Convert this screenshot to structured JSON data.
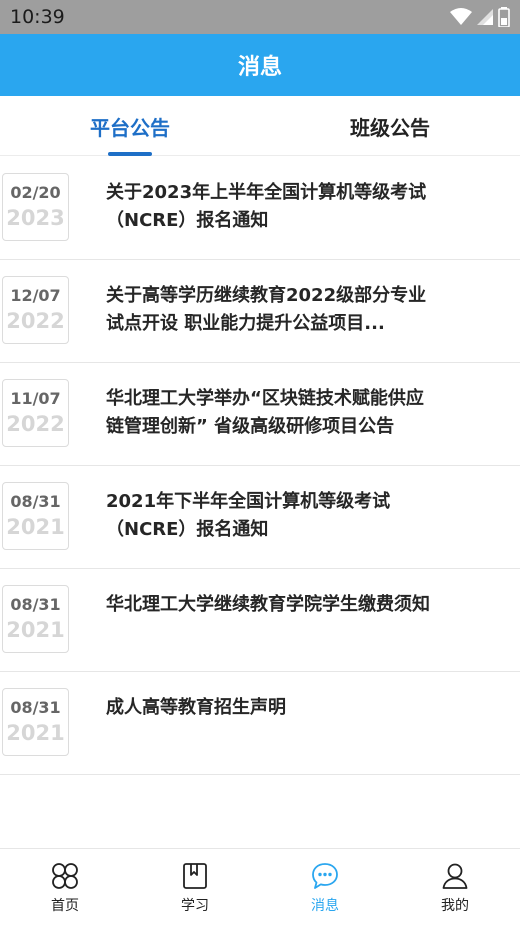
{
  "status_bar": {
    "time": "10:39"
  },
  "header": {
    "title": "消息"
  },
  "tabs": [
    {
      "label": "平台公告",
      "active": true
    },
    {
      "label": "班级公告",
      "active": false
    }
  ],
  "notices": [
    {
      "month_day": "02/20",
      "year": "2023",
      "title": "关于2023年上半年全国计算机等级考试（NCRE）报名通知"
    },
    {
      "month_day": "12/07",
      "year": "2022",
      "title": "关于高等学历继续教育2022级部分专业试点开设 职业能力提升公益项目..."
    },
    {
      "month_day": "11/07",
      "year": "2022",
      "title": "华北理工大学举办“区块链技术赋能供应链管理创新” 省级高级研修项目公告"
    },
    {
      "month_day": "08/31",
      "year": "2021",
      "title": "2021年下半年全国计算机等级考试（NCRE）报名通知"
    },
    {
      "month_day": "08/31",
      "year": "2021",
      "title": "华北理工大学继续教育学院学生缴费须知"
    },
    {
      "month_day": "08/31",
      "year": "2021",
      "title": "成人高等教育招生声明"
    }
  ],
  "bottom_nav": [
    {
      "label": "首页",
      "icon": "home-grid-icon",
      "active": false
    },
    {
      "label": "学习",
      "icon": "book-icon",
      "active": false
    },
    {
      "label": "消息",
      "icon": "chat-bubble-icon",
      "active": true
    },
    {
      "label": "我的",
      "icon": "person-icon",
      "active": false
    }
  ],
  "colors": {
    "app_bar": "#2aa6ef",
    "tab_active": "#1e6fc7",
    "nav_active": "#2aa6ef"
  }
}
